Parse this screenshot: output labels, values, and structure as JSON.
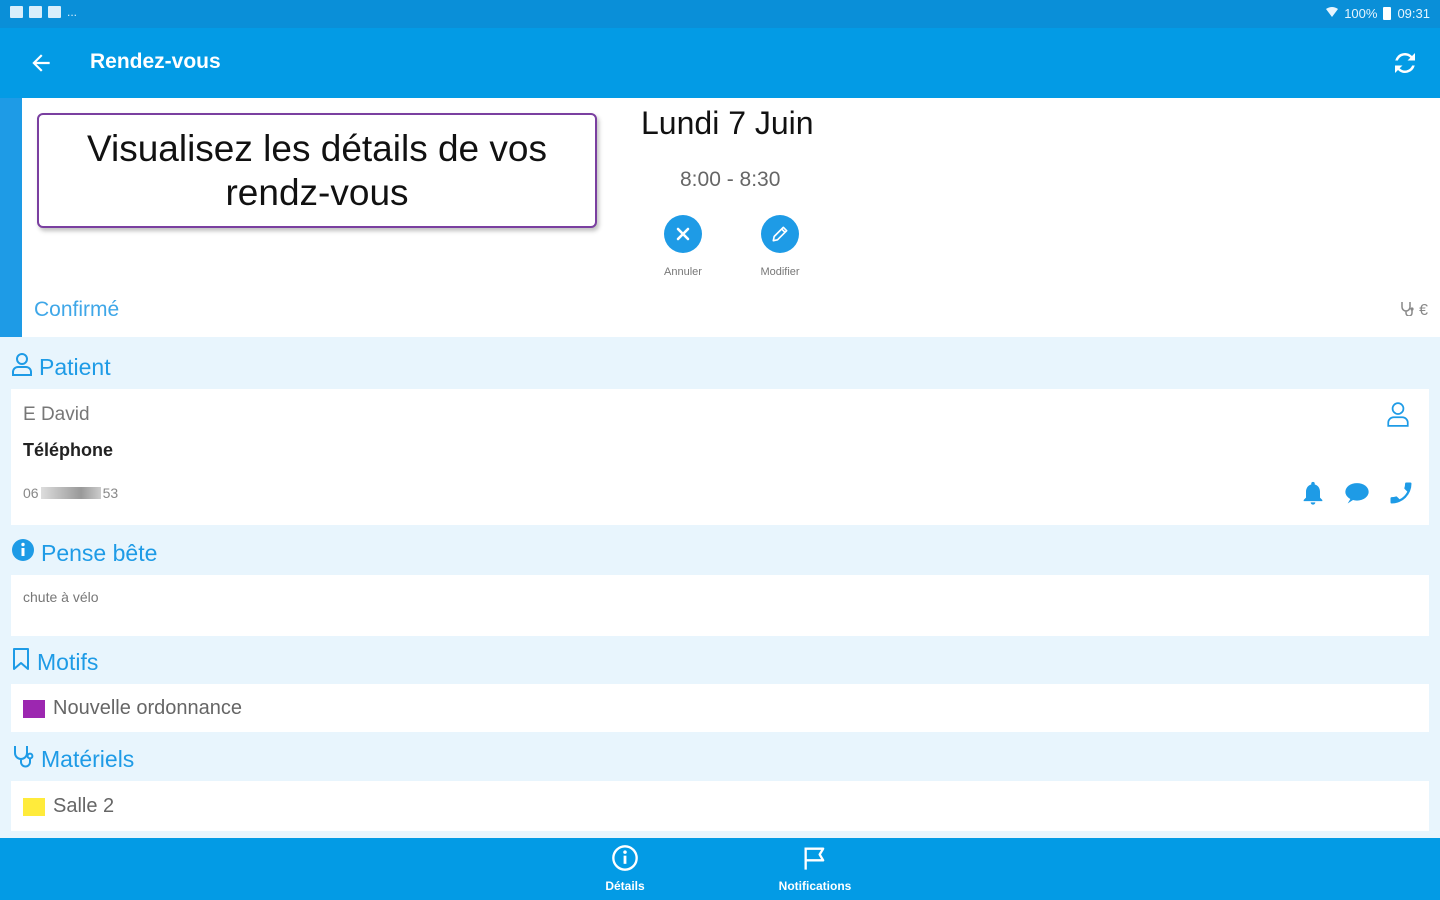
{
  "status_bar": {
    "battery": "100%",
    "time": "09:31",
    "more": "..."
  },
  "app_bar": {
    "title": "Rendez-vous"
  },
  "header": {
    "callout_text": "Visualisez les détails de vos rendz-vous",
    "date": "Lundi 7 Juin",
    "time_range": "8:00 - 8:30",
    "cancel_label": "Annuler",
    "edit_label": "Modifier",
    "status": "Confirmé",
    "currency_symbol": "€"
  },
  "patient": {
    "section_title": "Patient",
    "name": "E David",
    "phone_label": "Téléphone",
    "phone_prefix": "06",
    "phone_suffix": "53"
  },
  "note": {
    "section_title": "Pense bête",
    "text": "chute à vélo"
  },
  "motifs": {
    "section_title": "Motifs",
    "items": [
      {
        "label": "Nouvelle ordonnance",
        "color": "#9c27b0"
      }
    ]
  },
  "materiels": {
    "section_title": "Matériels",
    "items": [
      {
        "label": "Salle 2",
        "color": "#ffeb3b"
      }
    ]
  },
  "bottom_nav": {
    "details_label": "Détails",
    "notifications_label": "Notifications"
  },
  "colors": {
    "primary": "#039be5",
    "accent": "#1e9be6",
    "callout_border": "#7a3fa0"
  }
}
